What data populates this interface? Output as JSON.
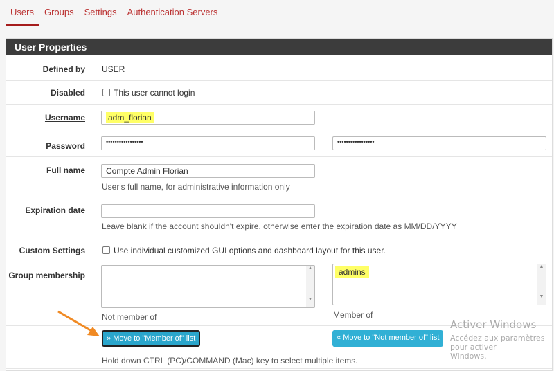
{
  "tabs": [
    "Users",
    "Groups",
    "Settings",
    "Authentication Servers"
  ],
  "panel_title": "User Properties",
  "defined_by": {
    "label": "Defined by",
    "value": "USER"
  },
  "disabled": {
    "label": "Disabled",
    "checkbox_label": "This user cannot login",
    "checked": false
  },
  "username": {
    "label": "Username",
    "value": "adm_florian"
  },
  "password": {
    "label": "Password",
    "value": "•••••••••••••••••",
    "confirm": "•••••••••••••••••"
  },
  "full_name": {
    "label": "Full name",
    "value": "Compte Admin Florian",
    "help": "User's full name, for administrative information only"
  },
  "expiration": {
    "label": "Expiration date",
    "value": "",
    "help": "Leave blank if the account shouldn't expire, otherwise enter the expiration date as MM/DD/YYYY"
  },
  "custom_settings": {
    "label": "Custom Settings",
    "checkbox_label": "Use individual customized GUI options and dashboard layout for this user.",
    "checked": false
  },
  "group_membership": {
    "label": "Group membership",
    "not_member_label": "Not member of",
    "member_label": "Member of",
    "not_member_items": [],
    "member_items": [
      "admins"
    ],
    "move_to_member": "Move to \"Member of\" list",
    "move_to_not_member": "Move to \"Not member of\" list",
    "help": "Hold down CTRL (PC)/COMMAND (Mac) key to select multiple items."
  },
  "watermark": {
    "title": "Activer Windows",
    "line1": "Accédez aux paramètres pour activer",
    "line2": "Windows."
  },
  "colors": {
    "accent": "#a51c1c",
    "button": "#31b0d5",
    "highlight": "#ffff66",
    "annotation_arrow": "#f08a24"
  }
}
